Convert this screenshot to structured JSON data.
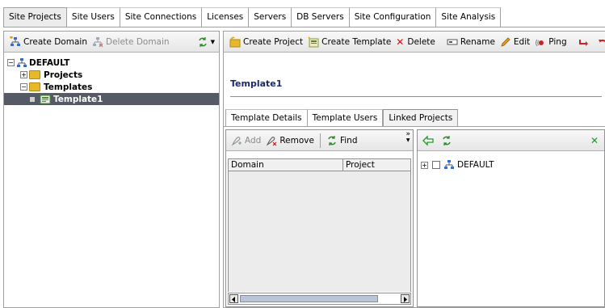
{
  "top_tabs": [
    "Site Projects",
    "Site Users",
    "Site Connections",
    "Licenses",
    "Servers",
    "DB Servers",
    "Site Configuration",
    "Site Analysis"
  ],
  "active_top_tab": "Site Projects",
  "left_toolbar": {
    "create_domain": "Create Domain",
    "delete_domain": "Delete Domain"
  },
  "tree": {
    "root": "DEFAULT",
    "projects": "Projects",
    "templates": "Templates",
    "template1": "Template1"
  },
  "right_toolbar": {
    "create_project": "Create Project",
    "create_template": "Create Template",
    "delete": "Delete",
    "rename": "Rename",
    "edit": "Edit",
    "ping": "Ping",
    "overflow": "»"
  },
  "detail": {
    "title": "Template1",
    "tabs": [
      "Template Details",
      "Template Users",
      "Linked Projects"
    ],
    "active_tab": "Linked Projects"
  },
  "linked_toolbar": {
    "add": "Add",
    "remove": "Remove",
    "find": "Find",
    "overflow": "»"
  },
  "grid": {
    "columns": [
      "Domain",
      "Project"
    ]
  },
  "right_tree": {
    "root": "DEFAULT"
  },
  "colors": {
    "selected_row": "#545b66",
    "folder": "#e8b82a",
    "delete_red": "#cc1111",
    "green": "#1a9a2a"
  }
}
